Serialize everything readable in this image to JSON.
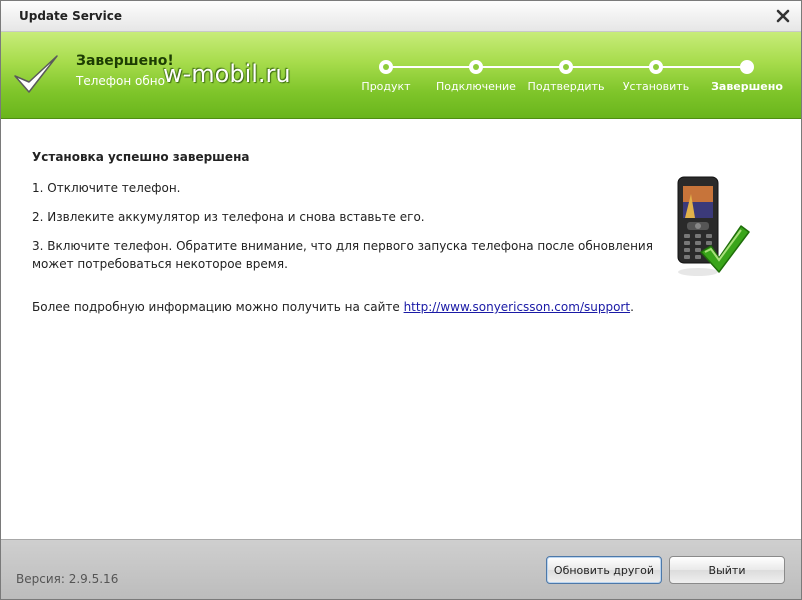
{
  "window": {
    "title": "Update Service"
  },
  "header": {
    "title": "Завершено!",
    "subtitle": "Телефон обно",
    "watermark": "w-mobil.ru",
    "steps": [
      {
        "label": "Продукт",
        "active": false
      },
      {
        "label": "Подключение",
        "active": false
      },
      {
        "label": "Подтвердить",
        "active": false
      },
      {
        "label": "Установить",
        "active": false
      },
      {
        "label": "Завершено",
        "active": true
      }
    ]
  },
  "content": {
    "title": "Установка успешно завершена",
    "step1": "1. Отключите телефон.",
    "step2": "2. Извлеките аккумулятор из телефона и снова вставьте его.",
    "step3": "3. Включите телефон. Обратите внимание, что для первого запуска телефона после обновления может потребоваться некоторое время.",
    "more_info_prefix": "Более подробную информацию можно получить на сайте ",
    "more_info_link": "http://www.sonyericsson.com/support",
    "more_info_suffix": "."
  },
  "footer": {
    "version": "Версия: 2.9.5.16",
    "update_other_label": "Обновить другой",
    "exit_label": "Выйти"
  },
  "colors": {
    "header_green": "#7fc52a",
    "link_blue": "#1a1aa6",
    "check_green": "#3aa51a"
  },
  "icons": {
    "close": "close-icon",
    "header_check": "checkmark-icon",
    "phone": "phone-with-checkmark-icon"
  }
}
